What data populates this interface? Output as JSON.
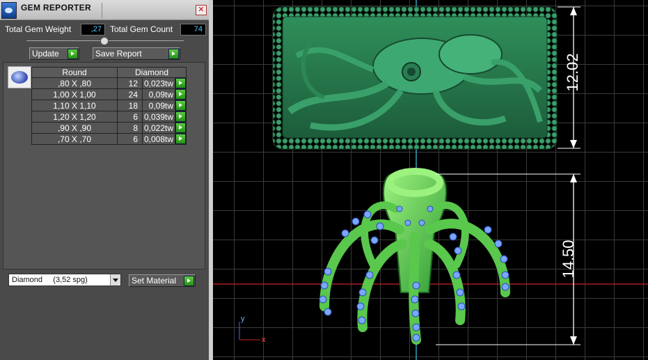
{
  "panel": {
    "title": "GEM REPORTER",
    "total_gem_weight_label": "Total Gem Weight",
    "total_gem_weight_value": ",27",
    "total_gem_count_label": "Total Gem Count",
    "total_gem_count_value": "74",
    "update_label": "Update",
    "save_report_label": "Save Report",
    "table": {
      "headers": [
        "Round",
        "Diamond"
      ],
      "rows": [
        {
          "size": ",80 X ,80",
          "count": "12",
          "weight": "0,023tw"
        },
        {
          "size": "1,00 X 1,00",
          "count": "24",
          "weight": "0,09tw"
        },
        {
          "size": "1,10 X 1,10",
          "count": "18",
          "weight": "0,09tw"
        },
        {
          "size": "1,20 X 1,20",
          "count": "6",
          "weight": "0,039tw"
        },
        {
          "size": ",90 X ,90",
          "count": "8",
          "weight": "0,022tw"
        },
        {
          "size": ",70 X ,70",
          "count": "6",
          "weight": "0,008tw"
        }
      ]
    },
    "material_selected": "Diamond     (3,52 spg)",
    "set_material_label": "Set Material"
  },
  "viewport": {
    "dimension_top": "12.02",
    "dimension_bottom": "14.50",
    "axis_y": "y",
    "axis_x": "x"
  },
  "colors": {
    "panel_bg": "#4a4a4a",
    "field_text": "#55ccff",
    "plaque_green": "#2e8a55",
    "pendant_green": "#6fe060",
    "gem_blue": "#7aa7ff",
    "dim_line": "#ffffff",
    "axis_red": "#cc2222",
    "axis_cyan": "#33a0c0"
  }
}
